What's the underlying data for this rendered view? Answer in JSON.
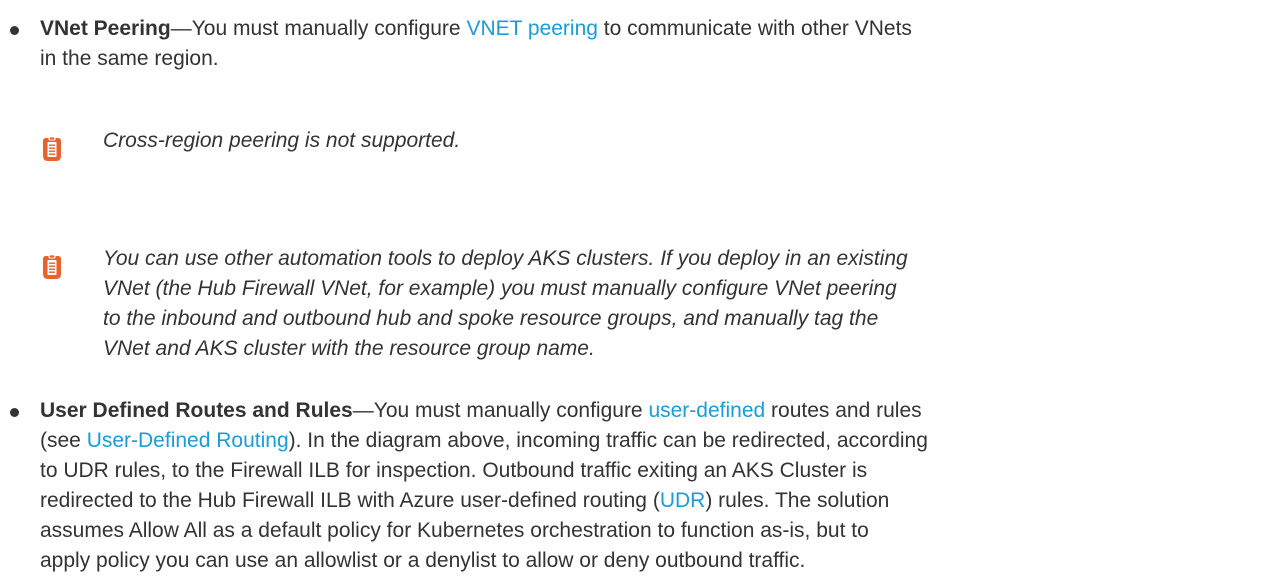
{
  "colors": {
    "text": "#333333",
    "link": "#1a9cd8",
    "note_icon": "#e8622c"
  },
  "bullet1": {
    "term": "VNet Peering",
    "dash": "—",
    "text_before_link": "You must manually configure ",
    "link": "VNET peering",
    "text_after_link": " to communicate with other VNets",
    "text_line2": "in the same region."
  },
  "note1": {
    "icon": "clipboard-note-icon",
    "text": "Cross-region peering is not supported."
  },
  "note2": {
    "icon": "clipboard-note-icon",
    "lines": [
      "You can use other automation tools to deploy AKS clusters. If you deploy in an existing",
      "VNet (the Hub Firewall VNet, for example) you must manually configure VNet peering",
      "to the inbound and outbound hub and spoke resource groups, and manually tag the",
      "VNet and AKS cluster with the resource group name."
    ]
  },
  "bullet2": {
    "term": "User Defined Routes and Rules",
    "dash": "—",
    "text_a": "You must manually configure ",
    "link_a": "user-defined",
    "text_b": " routes and rules",
    "text_c": "(see ",
    "link_b": "User-Defined Routing",
    "text_d": "). In the diagram above, incoming traffic can be redirected, according",
    "text_e": "to UDR rules, to the Firewall ILB for inspection. Outbound traffic exiting an AKS Cluster is",
    "text_f": "redirected to the Hub Firewall ILB with Azure user-defined routing (",
    "link_c": "UDR",
    "text_g": ") rules. The solution",
    "text_h": "assumes Allow All as a default policy for Kubernetes orchestration to function as-is, but to",
    "text_i": "apply policy you can use an allowlist or a denylist to allow or deny outbound traffic."
  }
}
